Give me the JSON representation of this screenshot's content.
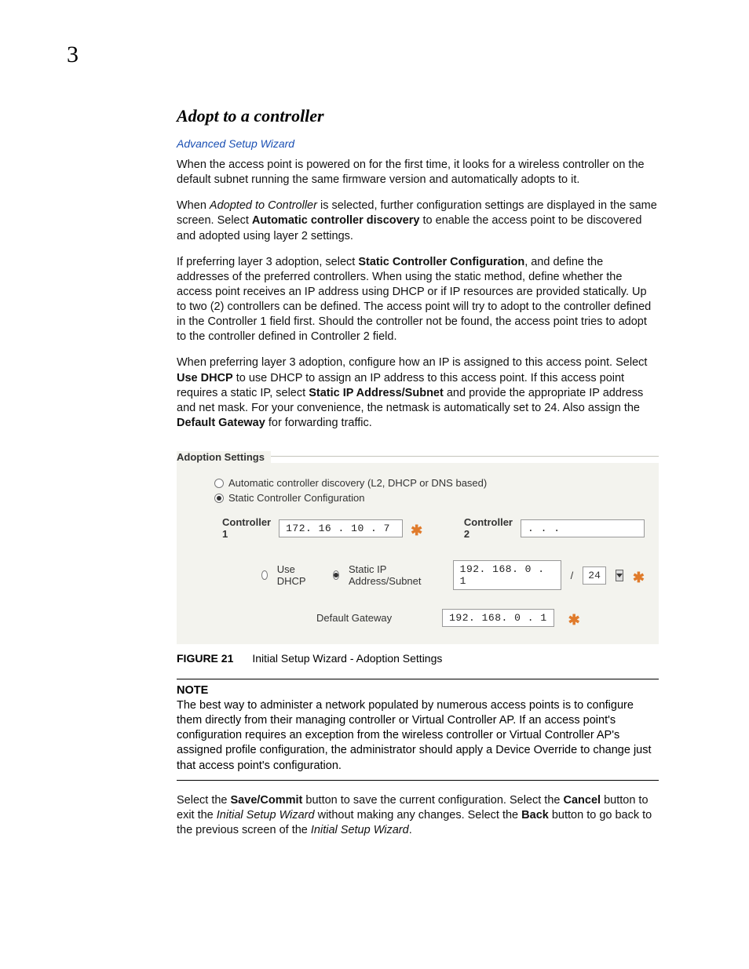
{
  "chapterNumber": "3",
  "sectionTitle": "Adopt to a controller",
  "breadcrumb": "Advanced Setup Wizard",
  "p1_a": "When the access point is powered on for the first time, it looks for a wireless controller on the default subnet running the same firmware version and automatically adopts to it.",
  "p2_a": "When ",
  "p2_i1": "Adopted to Controller",
  "p2_b": " is selected, further configuration settings are displayed in the same screen. Select ",
  "p2_b1": "Automatic controller discovery",
  "p2_c": " to enable the access point to be discovered and adopted using layer 2 settings.",
  "p3_a": "If preferring layer 3 adoption, select ",
  "p3_b1": "Static Controller Configuration",
  "p3_b": ", and define the addresses of the preferred controllers. When using the static method, define whether the access point receives an IP address using DHCP or if IP resources are provided statically. Up to two (2) controllers can be defined. The access point will try to adopt to the controller defined in the Controller 1 field first. Should the controller not be found, the access point tries to adopt to the controller defined in Controller 2 field.",
  "p4_a": "When preferring layer 3 adoption, configure how an IP is assigned to this access point. Select ",
  "p4_b1": "Use DHCP",
  "p4_b": " to use DHCP to assign an IP address to this access point. If this access point requires a static IP, select ",
  "p4_b2": "Static IP Address/Subnet",
  "p4_c": " and provide the appropriate IP address and net mask. For your convenience, the netmask is automatically set to 24. Also assign the ",
  "p4_b3": "Default Gateway",
  "p4_d": " for forwarding traffic.",
  "panel": {
    "legend": "Adoption Settings",
    "opt1": "Automatic controller discovery (L2, DHCP or DNS based)",
    "opt2": "Static Controller Configuration",
    "controller1Label": "Controller 1",
    "controller1Value": "172. 16 . 10 .  7",
    "controller2Label": "Controller 2",
    "controller2Value": "   .    .    .   ",
    "useDhcp": "Use DHCP",
    "staticIp": "Static IP Address/Subnet",
    "staticIpValue": "192. 168.  0 .  1",
    "maskValue": "24",
    "gwLabel": "Default Gateway",
    "gwValue": "192. 168.  0 .  1",
    "star": "✱"
  },
  "figCaptionBold": "FIGURE 21",
  "figCaptionText": "Initial Setup Wizard - Adoption Settings",
  "noteTitle": "NOTE",
  "noteBody": "The best way to administer a network populated by numerous access points is to configure them directly from their managing controller or Virtual Controller AP. If an access point's configuration requires an exception from the wireless controller or Virtual Controller AP's assigned profile configuration, the administrator should apply a Device Override to change just that access point's configuration.",
  "p5_a": "Select the ",
  "p5_b1": "Save/Commit",
  "p5_b": " button to save the current configuration. Select the ",
  "p5_b2": "Cancel",
  "p5_c": " button to exit the ",
  "p5_i1": "Initial Setup Wizard",
  "p5_d": " without making any changes. Select the ",
  "p5_b3": "Back",
  "p5_e": " button to go back to the previous screen of the ",
  "p5_i2": "Initial Setup Wizard",
  "p5_f": "."
}
